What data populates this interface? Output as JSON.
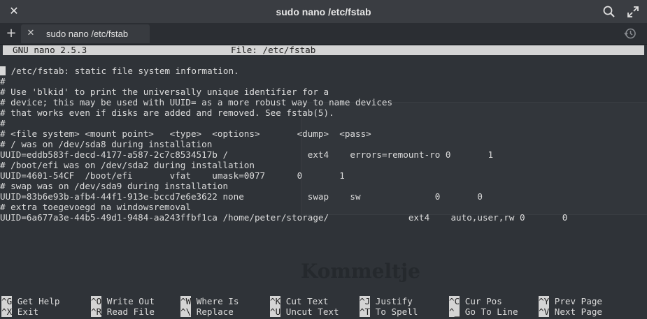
{
  "window": {
    "title": "sudo nano /etc/fstab",
    "icons": [
      "close-icon",
      "search-icon",
      "maximize-icon"
    ]
  },
  "tabs": {
    "add_label": "+",
    "items": [
      {
        "label": "sudo nano /etc/fstab",
        "close_label": "✕"
      }
    ],
    "history_icon": "history-icon"
  },
  "nano": {
    "header_left": "GNU nano 2.5.3",
    "header_center": "File: /etc/fstab",
    "lines": [
      " /etc/fstab: static file system information.",
      "#",
      "# Use 'blkid' to print the universally unique identifier for a",
      "# device; this may be used with UUID= as a more robust way to name devices",
      "# that works even if disks are added and removed. See fstab(5).",
      "#",
      "# <file system> <mount point>   <type>  <options>       <dump>  <pass>",
      "# / was on /dev/sda8 during installation",
      "UUID=eddb583f-decd-4177-a587-2c7c8534517b /               ext4    errors=remount-ro 0       1",
      "# /boot/efi was on /dev/sda2 during installation",
      "UUID=4601-54CF  /boot/efi       vfat    umask=0077      0       1",
      "# swap was on /dev/sda9 during installation",
      "UUID=83b6e93b-afb4-44f1-913e-bccd7e6e3622 none            swap    sw              0       0",
      "# extra toegevoegd na windowsremoval",
      "UUID=6a677a3e-44b5-49d1-9484-aa243ffbf1ca /home/peter/storage/               ext4    auto,user,rw 0       0"
    ]
  },
  "shortcuts": [
    {
      "key": "^G",
      "label": "Get Help"
    },
    {
      "key": "^O",
      "label": "Write Out"
    },
    {
      "key": "^W",
      "label": "Where Is"
    },
    {
      "key": "^K",
      "label": "Cut Text"
    },
    {
      "key": "^J",
      "label": "Justify"
    },
    {
      "key": "^C",
      "label": "Cur Pos"
    },
    {
      "key": "^Y",
      "label": "Prev Page"
    },
    {
      "key": "^X",
      "label": "Exit"
    },
    {
      "key": "^R",
      "label": "Read File"
    },
    {
      "key": "^\\",
      "label": "Replace"
    },
    {
      "key": "^U",
      "label": "Uncut Text"
    },
    {
      "key": "^T",
      "label": "To Spell"
    },
    {
      "key": "^_",
      "label": "Go To Line"
    },
    {
      "key": "^V",
      "label": "Next Page"
    }
  ],
  "background": {
    "logo_text": "Kommeltje"
  },
  "colors": {
    "terminal_bg": "#2f3338",
    "terminal_fg": "#dcdcdc",
    "inverse_bg": "#d4d4d4",
    "titlebar_bg": "#3a3d42"
  }
}
